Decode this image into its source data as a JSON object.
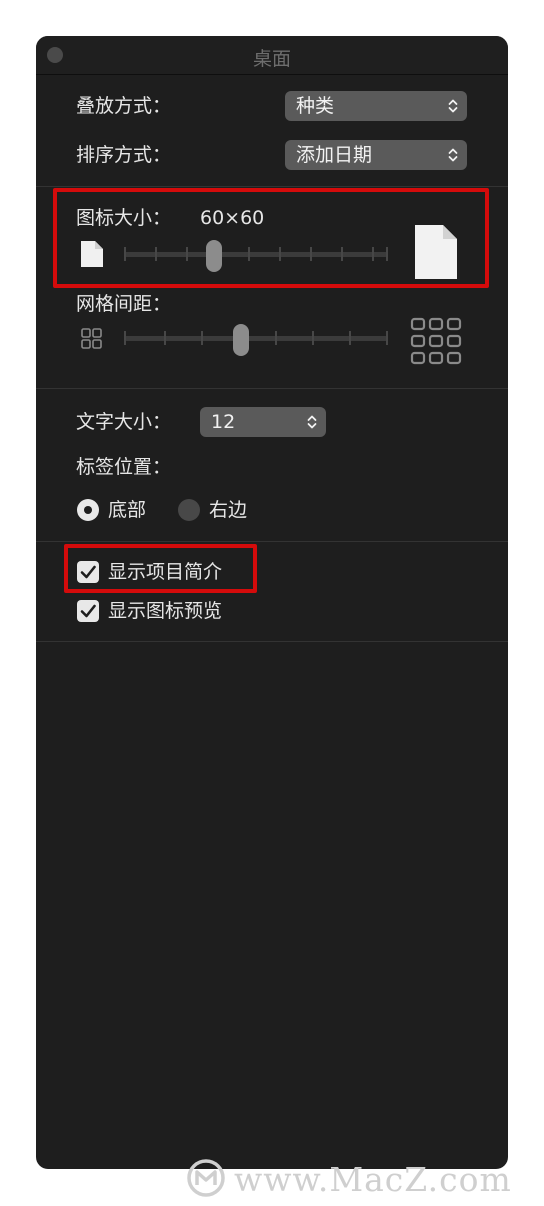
{
  "window": {
    "title": "桌面"
  },
  "stack_by": {
    "label": "叠放方式：",
    "value": "种类"
  },
  "sort_by": {
    "label": "排序方式：",
    "value": "添加日期"
  },
  "icon_size": {
    "label": "图标大小：",
    "value_text": "60×60",
    "level": 0.33
  },
  "grid_spacing": {
    "label": "网格间距：",
    "level": 0.44
  },
  "text_size": {
    "label": "文字大小：",
    "value": "12"
  },
  "label_position": {
    "label": "标签位置：",
    "options": [
      "底部",
      "右边"
    ],
    "selected": "底部"
  },
  "checkboxes": {
    "show_item_info": "显示项目简介",
    "show_icon_preview": "显示图标预览"
  },
  "watermark": {
    "text": "www.MacZ.com"
  },
  "colors": {
    "panel": "#1e1e1e",
    "highlight_box": "#d40b0b",
    "control": "#5a5a5a"
  }
}
